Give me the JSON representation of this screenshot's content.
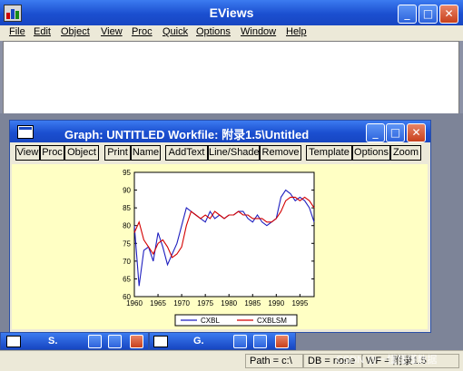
{
  "app": {
    "title": "EViews",
    "icon": "eviews-app-icon"
  },
  "menu": [
    "File",
    "Edit",
    "Object",
    "View",
    "Proc",
    "Quick",
    "Options",
    "Window",
    "Help"
  ],
  "graph_window": {
    "title": "Graph: UNTITLED   Workfile: 附录1.5\\Untitled",
    "toolbar": [
      "View",
      "Proc",
      "Object",
      "Print",
      "Name",
      "AddText",
      "Line/Shade",
      "Remove",
      "Template",
      "Options",
      "Zoom"
    ]
  },
  "minimized": [
    {
      "label": "S."
    },
    {
      "label": "G."
    }
  ],
  "status": {
    "path": "Path = c:\\",
    "db": "DB = none",
    "wf": "WF = 附录1.5"
  },
  "watermark": "CSDN @一懂懂懂数据",
  "colors": {
    "titlebar": "#1b4fd0",
    "plot_bg": "#ffffc4",
    "series1": "#1f1fbf",
    "series2": "#d40000"
  },
  "chart_data": {
    "type": "line",
    "xlim": [
      1960,
      1998
    ],
    "ylim": [
      60,
      95
    ],
    "yticks": [
      60,
      65,
      70,
      75,
      80,
      85,
      90,
      95
    ],
    "xticks": [
      1960,
      1965,
      1970,
      1975,
      1980,
      1985,
      1990,
      1995
    ],
    "series": [
      {
        "name": "CXBL",
        "x": [
          1960,
          1961,
          1962,
          1963,
          1964,
          1965,
          1966,
          1967,
          1968,
          1969,
          1970,
          1971,
          1972,
          1973,
          1974,
          1975,
          1976,
          1977,
          1978,
          1979,
          1980,
          1981,
          1982,
          1983,
          1984,
          1985,
          1986,
          1987,
          1988,
          1989,
          1990,
          1991,
          1992,
          1993,
          1994,
          1995,
          1996,
          1997,
          1998
        ],
        "y": [
          80,
          63,
          73,
          74,
          70,
          78,
          74,
          69,
          72,
          75,
          80,
          85,
          84,
          83,
          82,
          81,
          84,
          82,
          83,
          82,
          83,
          83,
          84,
          84,
          82,
          81,
          83,
          81,
          80,
          81,
          82,
          88,
          90,
          89,
          87,
          88,
          87,
          85,
          81
        ]
      },
      {
        "name": "CXBLSM",
        "x": [
          1960,
          1961,
          1962,
          1963,
          1964,
          1965,
          1966,
          1967,
          1968,
          1969,
          1970,
          1971,
          1972,
          1973,
          1974,
          1975,
          1976,
          1977,
          1978,
          1979,
          1980,
          1981,
          1982,
          1983,
          1984,
          1985,
          1986,
          1987,
          1988,
          1989,
          1990,
          1991,
          1992,
          1993,
          1994,
          1995,
          1996,
          1997,
          1998
        ],
        "y": [
          78,
          81,
          76,
          74,
          72,
          75,
          76,
          74,
          71,
          72,
          74,
          80,
          84,
          83,
          82,
          83,
          82,
          84,
          83,
          82,
          83,
          83,
          84,
          83,
          83,
          82,
          82,
          82,
          81,
          81,
          82,
          84,
          87,
          88,
          88,
          87,
          88,
          87,
          85
        ]
      }
    ]
  }
}
